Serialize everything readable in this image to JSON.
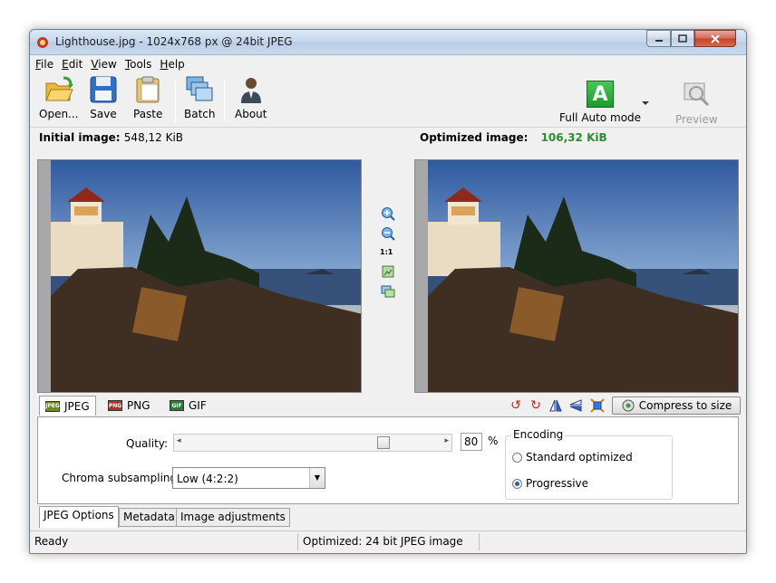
{
  "window": {
    "title": "Lighthouse.jpg - 1024x768 px @ 24bit JPEG"
  },
  "menu": [
    {
      "label": "File",
      "mnemonic": "F",
      "rest": "ile"
    },
    {
      "label": "Edit",
      "mnemonic": "E",
      "rest": "dit"
    },
    {
      "label": "View",
      "mnemonic": "V",
      "rest": "iew"
    },
    {
      "label": "Tools",
      "mnemonic": "T",
      "rest": "ools"
    },
    {
      "label": "Help",
      "mnemonic": "H",
      "rest": "elp"
    }
  ],
  "toolbar": {
    "open_label": "Open...",
    "save_label": "Save",
    "paste_label": "Paste",
    "batch_label": "Batch",
    "about_label": "About",
    "full_auto_label": "Full Auto mode",
    "full_auto_letter": "A",
    "preview_label": "Preview"
  },
  "info": {
    "initial_label": "Initial image:",
    "initial_value": "548,12 KiB",
    "optimized_label": "Optimized image:",
    "optimized_value": "106,32 KiB"
  },
  "zoom": {
    "one_to_one": "1:1"
  },
  "format_tabs": {
    "jpeg": "JPEG",
    "png": "PNG",
    "gif": "GIF",
    "jpeg_badge": "JPEG",
    "png_badge": "PNG",
    "gif_badge": "GIF"
  },
  "compress": {
    "label": "Compress to size"
  },
  "options": {
    "quality_label": "Quality:",
    "quality_value": "80",
    "quality_unit": "%",
    "quality_fraction": 0.8,
    "chroma_label": "Chroma subsampling:",
    "chroma_value": "Low (4:2:2)",
    "encoding_legend": "Encoding",
    "standard_label": "Standard optimized",
    "progressive_label": "Progressive",
    "selected_encoding": "Progressive"
  },
  "bottom_tabs": {
    "jpeg_options": "JPEG Options",
    "metadata": "Metadata",
    "image_adjustments": "Image adjustments"
  },
  "status": {
    "left": "Ready",
    "middle": "Optimized: 24 bit JPEG image"
  },
  "colors": {
    "optimized_value": "#2e8b2e",
    "full_auto": "#2cab3c",
    "accent_blue": "#2a5fa8"
  }
}
